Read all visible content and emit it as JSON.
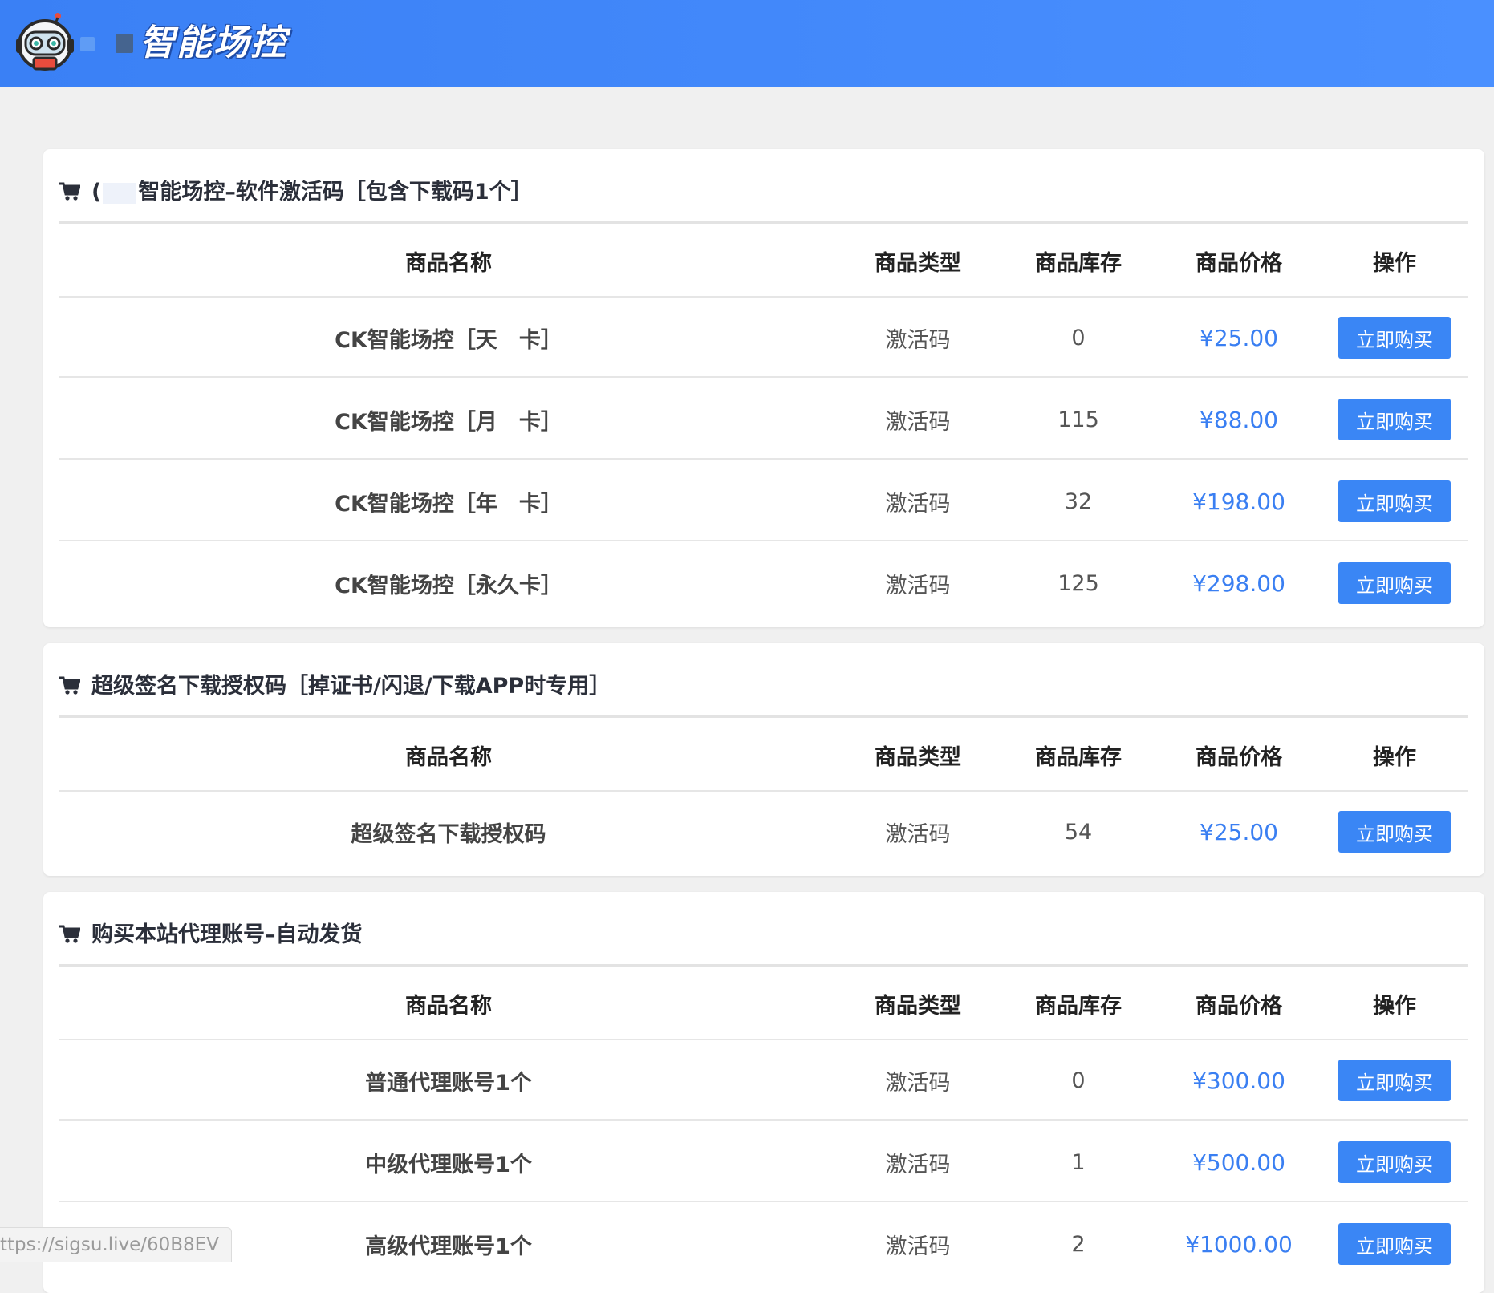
{
  "header": {
    "brand_title": "智能场控",
    "logo_icon": "robot-icon",
    "background": "#3f89f8"
  },
  "colors": {
    "accent": "#3a86f5",
    "price": "#3a7ff2"
  },
  "table_headers": {
    "name": "商品名称",
    "type": "商品类型",
    "stock": "商品库存",
    "price": "商品价格",
    "op": "操作"
  },
  "buy_label": "立即购买",
  "sections": [
    {
      "title_prefix": "(",
      "title": "智能场控–软件激活码［包含下载码1个］",
      "items": [
        {
          "name": "CK智能场控［天　卡］",
          "type": "激活码",
          "stock": "0",
          "price": "¥25.00"
        },
        {
          "name": "CK智能场控［月　卡］",
          "type": "激活码",
          "stock": "115",
          "price": "¥88.00"
        },
        {
          "name": "CK智能场控［年　卡］",
          "type": "激活码",
          "stock": "32",
          "price": "¥198.00"
        },
        {
          "name": "CK智能场控［永久卡］",
          "type": "激活码",
          "stock": "125",
          "price": "¥298.00"
        }
      ]
    },
    {
      "title": "超级签名下载授权码［掉证书/闪退/下载APP时专用］",
      "items": [
        {
          "name": "超级签名下载授权码",
          "type": "激活码",
          "stock": "54",
          "price": "¥25.00"
        }
      ]
    },
    {
      "title": "购买本站代理账号–自动发货",
      "items": [
        {
          "name": "普通代理账号1个",
          "type": "激活码",
          "stock": "0",
          "price": "¥300.00"
        },
        {
          "name": "中级代理账号1个",
          "type": "激活码",
          "stock": "1",
          "price": "¥500.00"
        },
        {
          "name": "高级代理账号1个",
          "type": "激活码",
          "stock": "2",
          "price": "¥1000.00"
        }
      ]
    }
  ],
  "status_bar": {
    "url": "ttps://sigsu.live/60B8EV"
  }
}
